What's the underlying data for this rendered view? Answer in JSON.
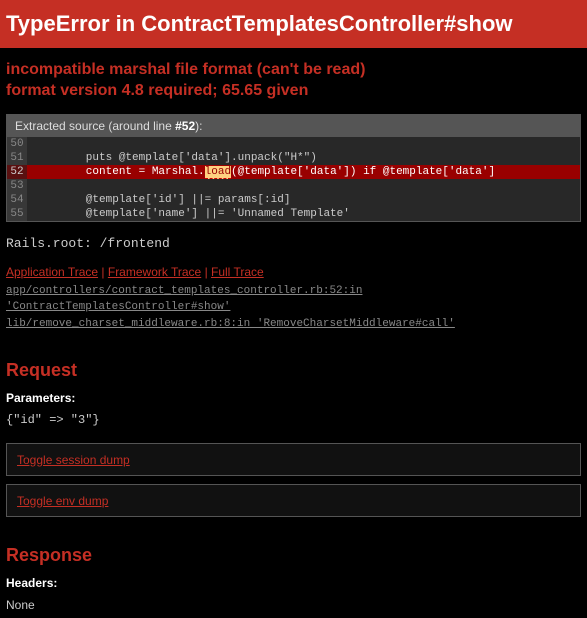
{
  "title": "TypeError in ContractTemplatesController#show",
  "error": {
    "line1": "incompatible marshal file format (can't be read)",
    "line2": "format version 4.8 required; 65.65 given"
  },
  "source": {
    "label_pre": "Extracted source (around line ",
    "label_line": "#52",
    "label_post": "):",
    "lines": [
      {
        "n": "50",
        "code": ""
      },
      {
        "n": "51",
        "code": "        puts @template['data'].unpack(\"H*\")"
      },
      {
        "n": "52",
        "pre": "        content = Marshal.",
        "hl": "load",
        "post": "(@template['data']) if @template['data']",
        "highlight": true
      },
      {
        "n": "53",
        "code": ""
      },
      {
        "n": "54",
        "code": "        @template['id'] ||= params[:id]"
      },
      {
        "n": "55",
        "code": "        @template['name'] ||= 'Unnamed Template'"
      }
    ]
  },
  "rails_root": "Rails.root: /frontend",
  "traces": {
    "app": "Application Trace",
    "framework": "Framework Trace",
    "full": "Full Trace"
  },
  "trace_lines": [
    "app/controllers/contract_templates_controller.rb:52:in 'ContractTemplatesController#show'",
    "lib/remove_charset_middleware.rb:8:in 'RemoveCharsetMiddleware#call'"
  ],
  "request": {
    "heading": "Request",
    "params_label": "Parameters",
    "params_value": "{\"id\" => \"3\"}",
    "toggle_session": "Toggle session dump",
    "toggle_env": "Toggle env dump"
  },
  "response": {
    "heading": "Response",
    "headers_label": "Headers",
    "none": "None"
  }
}
